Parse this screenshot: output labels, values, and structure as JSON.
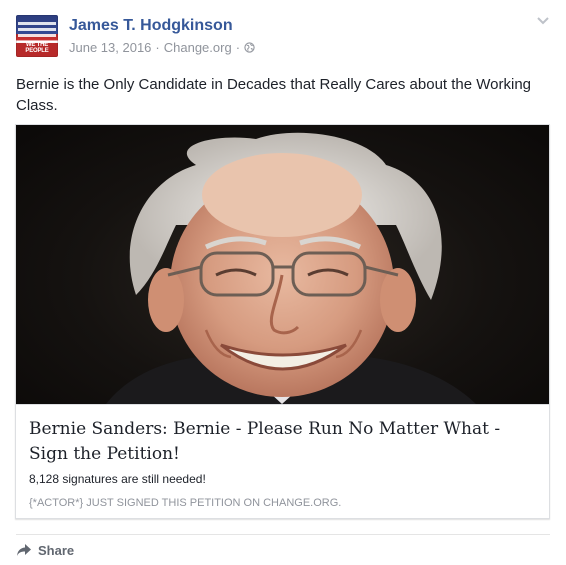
{
  "post": {
    "author": "James T. Hodgkinson",
    "date": "June 13, 2016",
    "separator": "·",
    "source": "Change.org",
    "avatar_text": "WE THE PEOPLE",
    "text": "Bernie is the Only Candidate in Decades that Really Cares about the Working Class."
  },
  "link_card": {
    "title": "Bernie Sanders: Bernie - Please Run No Matter What - Sign the Petition!",
    "subtitle": "8,128 signatures are still needed!",
    "caption": "{*ACTOR*} JUST SIGNED THIS PETITION ON CHANGE.ORG.",
    "image": "portrait-photo"
  },
  "footer": {
    "share_label": "Share"
  },
  "colors": {
    "author_link": "#365899",
    "meta_gray": "#90949c",
    "text_dark": "#1d2129",
    "border": "#dddfe2"
  },
  "icons": {
    "privacy": "globe-icon",
    "menu": "chevron-down-icon",
    "share": "share-icon"
  }
}
